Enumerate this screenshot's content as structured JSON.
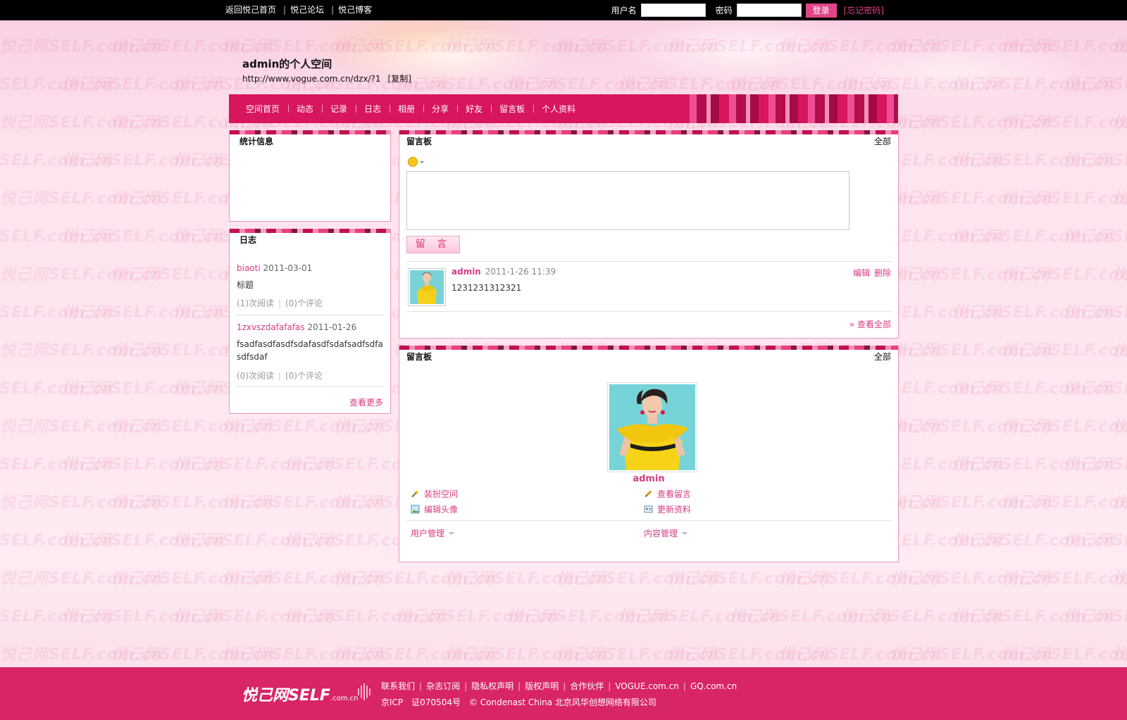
{
  "topbar": {
    "links": [
      "返回悦己首页",
      "悦己论坛",
      "悦己博客"
    ],
    "username_label": "用户名",
    "password_label": "密码",
    "login_button": "登录",
    "forgot_link": "[忘记密码]"
  },
  "header": {
    "title": "admin的个人空间",
    "url": "http://www.vogue.com.cn/dzx/?1",
    "copy_link": "[复制]"
  },
  "nav": {
    "items": [
      "空间首页",
      "动态",
      "记录",
      "日志",
      "相册",
      "分享",
      "好友",
      "留言板",
      "个人资料"
    ]
  },
  "watermark": "悦己网SELF.com.cn",
  "stats_panel": {
    "title": "统计信息"
  },
  "blog_panel": {
    "title": "日志",
    "entries": [
      {
        "title": "biaoti",
        "date": "2011-03-01",
        "summary": "标题",
        "reads": "(1)次阅读",
        "comments": "(0)个评论"
      },
      {
        "title": "1zxvszdafafafas",
        "date": "2011-01-26",
        "summary": "fsadfasdfasdfsdafasdfsdafsadfsdfasdfsdaf",
        "reads": "(0)次阅读",
        "comments": "(0)个评论"
      }
    ],
    "more": "查看更多"
  },
  "guestbook_panel": {
    "title": "留言板",
    "all": "全部",
    "post_button": "留 言",
    "message": {
      "author": "admin",
      "time": "2011-1-26 11:39",
      "text": "1231231312321",
      "edit": "编辑",
      "delete": "删除"
    },
    "view_all": "» 查看全部"
  },
  "profile_panel": {
    "title": "留言板",
    "all": "全部",
    "username": "admin",
    "links": {
      "decorate": "装扮空间",
      "view_messages": "查看留言",
      "edit_avatar": "编辑头像",
      "update_profile": "更新资料"
    },
    "user_manage": "用户管理",
    "content_manage": "内容管理"
  },
  "footer": {
    "logo": "悦己网SELF",
    "logo_small": ".com.cn",
    "links": [
      "联系我们",
      "杂志订阅",
      "隐私权声明",
      "版权声明",
      "合作伙伴",
      "VOGUE.com.cn",
      "GQ.com.cn"
    ],
    "icp": "京ICP　证070504号　© Condenast China 北京风华创想网络有限公司"
  },
  "colors": {
    "accent": "#d8155f",
    "link": "#d63c82",
    "footer": "#d82566"
  }
}
